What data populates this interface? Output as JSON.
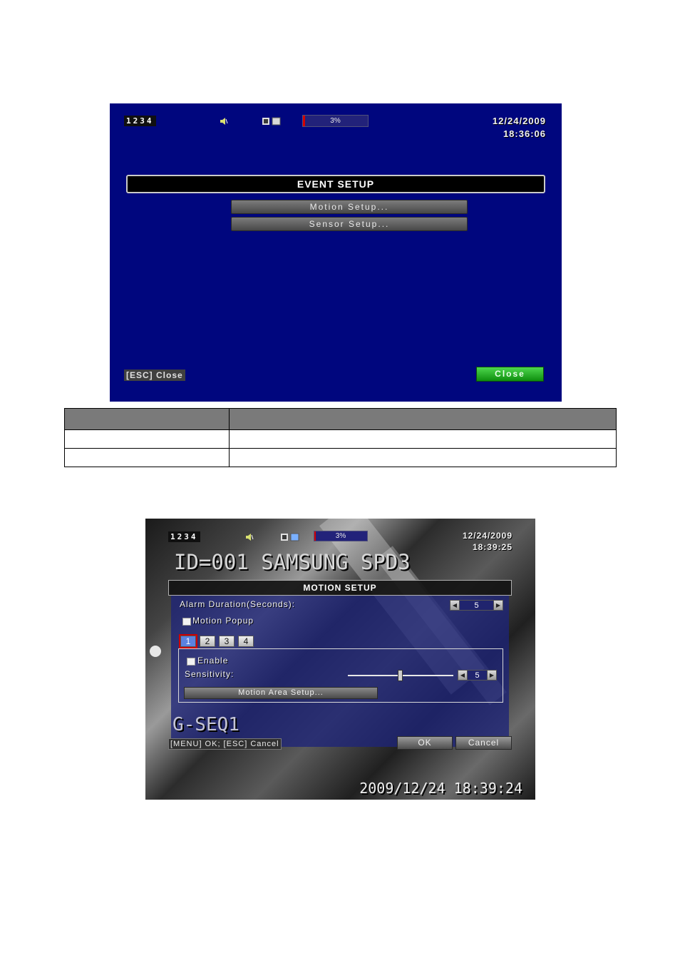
{
  "screen1": {
    "channels": "1234",
    "hdd_usage": "3%",
    "date": "12/24/2009",
    "time": "18:36:06",
    "title": "EVENT SETUP",
    "menu_items": [
      "Motion Setup...",
      "Sensor Setup..."
    ],
    "esc_hint": "[ESC] Close",
    "close_label": "Close",
    "colors": {
      "background": "#00067e",
      "close_button": "#1aa01a"
    }
  },
  "table": {
    "headers": [
      "",
      ""
    ],
    "rows": [
      [
        "",
        ""
      ],
      [
        "",
        ""
      ]
    ]
  },
  "screen2": {
    "channels": "1234",
    "hdd_usage": "3%",
    "date": "12/24/2009",
    "time": "18:39:25",
    "camera_title": "ID=001 SAMSUNG SPD3",
    "title": "MOTION SETUP",
    "alarm_duration_label": "Alarm Duration(Seconds):",
    "alarm_duration_value": "5",
    "motion_popup_label": "Motion Popup",
    "channel_tabs": [
      "1",
      "2",
      "3",
      "4"
    ],
    "active_tab": "1",
    "enable_label": "Enable",
    "sensitivity_label": "Sensitivity:",
    "sensitivity_value": "5",
    "motion_area_label": "Motion Area Setup...",
    "sequence_label": "G-SEQ1",
    "hint": "[MENU] OK; [ESC] Cancel",
    "ok_label": "OK",
    "cancel_label": "Cancel",
    "timestamp": "2009/12/24  18:39:24",
    "icons": [
      "speaker-icon",
      "hdd-icon",
      "left-arrow-icon",
      "right-arrow-icon"
    ]
  }
}
